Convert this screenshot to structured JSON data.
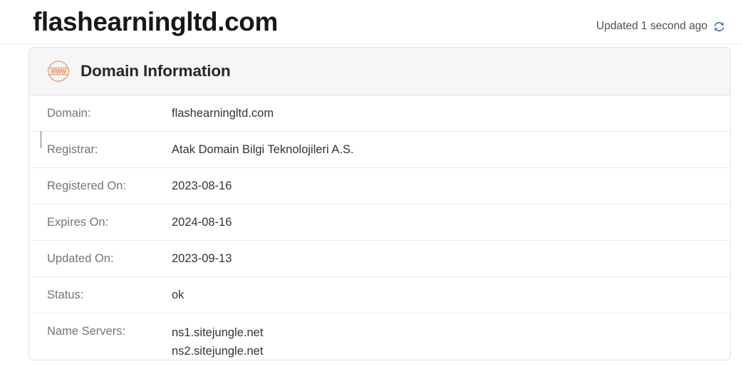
{
  "header": {
    "title": "flashearningltd.com",
    "updated_text": "Updated 1 second ago",
    "refresh_icon": "refresh-icon"
  },
  "card": {
    "icon": "www-globe-icon",
    "title": "Domain Information",
    "rows": [
      {
        "label": "Domain:",
        "value": "flashearningltd.com"
      },
      {
        "label": "Registrar:",
        "value": "Atak Domain Bilgi Teknolojileri A.S."
      },
      {
        "label": "Registered On:",
        "value": "2023-08-16"
      },
      {
        "label": "Expires On:",
        "value": "2024-08-16"
      },
      {
        "label": "Updated On:",
        "value": "2023-09-13"
      },
      {
        "label": "Status:",
        "value": "ok"
      },
      {
        "label": "Name Servers:",
        "value": "",
        "value_lines": [
          "ns1.sitejungle.net",
          "ns2.sitejungle.net"
        ]
      }
    ]
  },
  "colors": {
    "page_background": "#ffffff",
    "card_border": "#e2e4e6",
    "card_header_background": "#f6f6f7",
    "label_text": "#6f767d",
    "value_text": "#2f353a",
    "title_text": "#16191c",
    "refresh_icon_accent": "#4a6fa5",
    "www_icon_accent": "#e0a179"
  }
}
